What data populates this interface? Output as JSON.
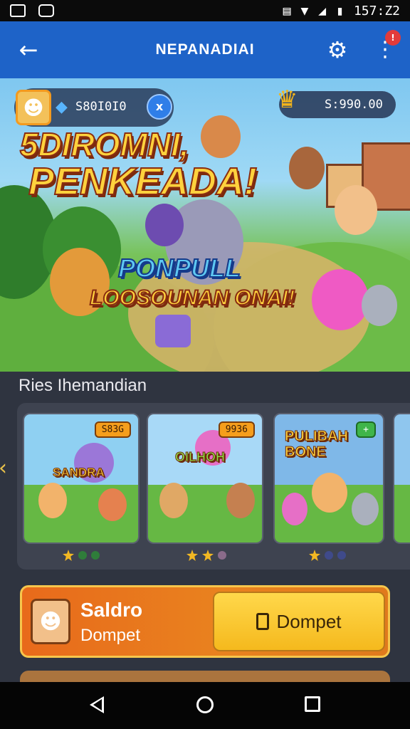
{
  "status_bar": {
    "time": "157:Z2"
  },
  "app_bar": {
    "title": "NEPANADIAI",
    "notification_count": "!"
  },
  "hero": {
    "currency_value": "S80I0I0",
    "add_label": "x",
    "coins_value": "S:990.00",
    "headline_line1": "5DIROMNI,",
    "headline_line2": "PENKEADA!",
    "subline1": "PONPULL",
    "subline2": "LOOSOUNAN ONAI!"
  },
  "section": {
    "title": "Ries Ihemandian"
  },
  "cards": [
    {
      "title": "SANDRA",
      "price": "S83G",
      "sky": "#8fd0f2",
      "rating": [
        1,
        1,
        0
      ]
    },
    {
      "title": "OILHOH",
      "price": "9936",
      "sky": "#a8d9f7",
      "rating": [
        1,
        1,
        0
      ]
    },
    {
      "title": "PULIBAH BONE",
      "price": "+",
      "sky": "#7fb8e8",
      "rating": [
        1,
        0,
        0
      ]
    }
  ],
  "wallet": {
    "line1": "Saldro",
    "line2": "Dompet",
    "button": "Dompet"
  },
  "icons": {
    "back": "arrow-left-icon",
    "settings": "gear-icon",
    "more": "more-vert-icon"
  }
}
